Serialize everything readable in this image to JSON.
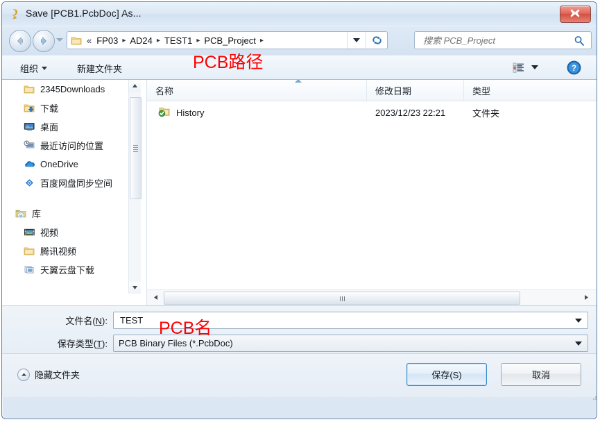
{
  "window": {
    "title": "Save [PCB1.PcbDoc] As...",
    "title_icon": "altium-document-icon",
    "close_label": "close-icon"
  },
  "nav": {
    "back_icon": "arrow-back-icon",
    "forward_icon": "arrow-forward-icon",
    "history_dropdown_icon": "chevron-down-icon",
    "address_folder_icon": "folder-icon",
    "breadcrumb_overflow": "«",
    "breadcrumbs": [
      "FP03",
      "AD24",
      "TEST1",
      "PCB_Project"
    ],
    "breadcrumb_separator": "▸",
    "address_dropdown_icon": "chevron-down-icon",
    "refresh_icon": "refresh-icon"
  },
  "search": {
    "placeholder": "搜索 PCB_Project",
    "value": "",
    "icon": "search-icon"
  },
  "command_bar": {
    "organize_label": "组织",
    "new_folder_label": "新建文件夹",
    "view_icon": "view-list-icon",
    "view_dropdown_icon": "chevron-down-icon",
    "help_icon": "help-icon"
  },
  "annotations": {
    "path_note": "PCB路径",
    "name_note": "PCB名",
    "color": "#ff0000"
  },
  "sidebar": {
    "items": [
      {
        "label": "2345Downloads",
        "icon": "folder-icon",
        "indent": "sub"
      },
      {
        "label": "下载",
        "icon": "downloads-folder-icon",
        "indent": "sub"
      },
      {
        "label": "桌面",
        "icon": "desktop-icon",
        "indent": "sub"
      },
      {
        "label": "最近访问的位置",
        "icon": "recent-places-icon",
        "indent": "sub"
      },
      {
        "label": "OneDrive",
        "icon": "onedrive-cloud-icon",
        "indent": "sub"
      },
      {
        "label": "百度网盘同步空间",
        "icon": "baidu-netdisk-icon",
        "indent": "sub"
      }
    ],
    "group2": [
      {
        "label": "库",
        "icon": "library-icon",
        "indent": "top"
      },
      {
        "label": "视频",
        "icon": "video-icon",
        "indent": "sub"
      },
      {
        "label": "腾讯视频",
        "icon": "folder-icon",
        "indent": "sub"
      },
      {
        "label": "天翼云盘下载",
        "icon": "cloud-download-icon",
        "indent": "sub"
      }
    ],
    "scroll_up_icon": "scroll-up-icon",
    "scroll_down_icon": "scroll-down-icon"
  },
  "file_list": {
    "columns": [
      "名称",
      "修改日期",
      "类型"
    ],
    "sort_indicator": "sort-ascending-caret",
    "rows": [
      {
        "name": "History",
        "icon": "folder-checked-icon",
        "date": "2023/12/23 22:21",
        "type": "文件夹"
      }
    ],
    "hscroll_left_icon": "scroll-left-icon",
    "hscroll_right_icon": "scroll-right-icon"
  },
  "form": {
    "filename_label": "文件名(N):",
    "filename_label_plain": "文件名(",
    "filename_label_key": "N",
    "filename_label_tail": "):",
    "filename_value": "TEST",
    "filetype_label_plain": "保存类型(",
    "filetype_label_key": "T",
    "filetype_label_tail": "):",
    "filetype_value": "PCB Binary Files (*.PcbDoc)"
  },
  "footer": {
    "hide_folders_label": "隐藏文件夹",
    "hide_folders_icon": "collapse-up-icon",
    "save_label": "保存(S)",
    "cancel_label": "取消"
  }
}
